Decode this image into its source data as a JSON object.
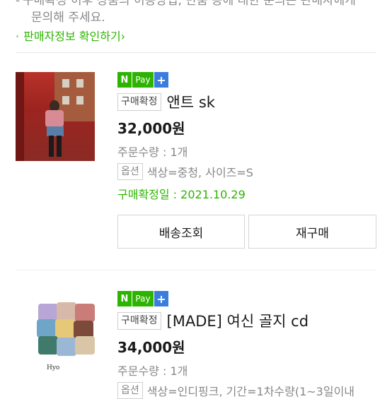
{
  "notice": {
    "bullet": "-",
    "line1": "구매확정 이후 상품의 이용방법, 반품 등에 대한 문의는 판매자에게",
    "line2": "문의해 주세요."
  },
  "seller_link": {
    "label": "판매자정보 확인하기",
    "chevron": "›"
  },
  "npay": {
    "n": "N",
    "pay": "Pay",
    "plus": "+"
  },
  "orders": [
    {
      "status": "구매확정",
      "product_name": "앤트 sk",
      "price": "32,000원",
      "quantity": "주문수량 : 1개",
      "option_label": "옵션",
      "option_value": "색상=중청, 사이즈=S",
      "confirm_date": "구매확정일 : 2021.10.29",
      "buttons": {
        "track": "배송조회",
        "rebuy": "재구매"
      }
    },
    {
      "status": "구매확정",
      "product_name": "[MADE] 여신 골지 cd",
      "price": "34,000원",
      "quantity": "주문수량 : 1개",
      "option_label": "옵션",
      "option_value": "색상=인디핑크, 기간=1차수량(1~3일이내"
    }
  ],
  "thumb2_brand": "Hyo",
  "colors": {
    "naver_green": "#2db400",
    "plus_blue": "#3b7ddd",
    "muted_text": "#888888"
  }
}
